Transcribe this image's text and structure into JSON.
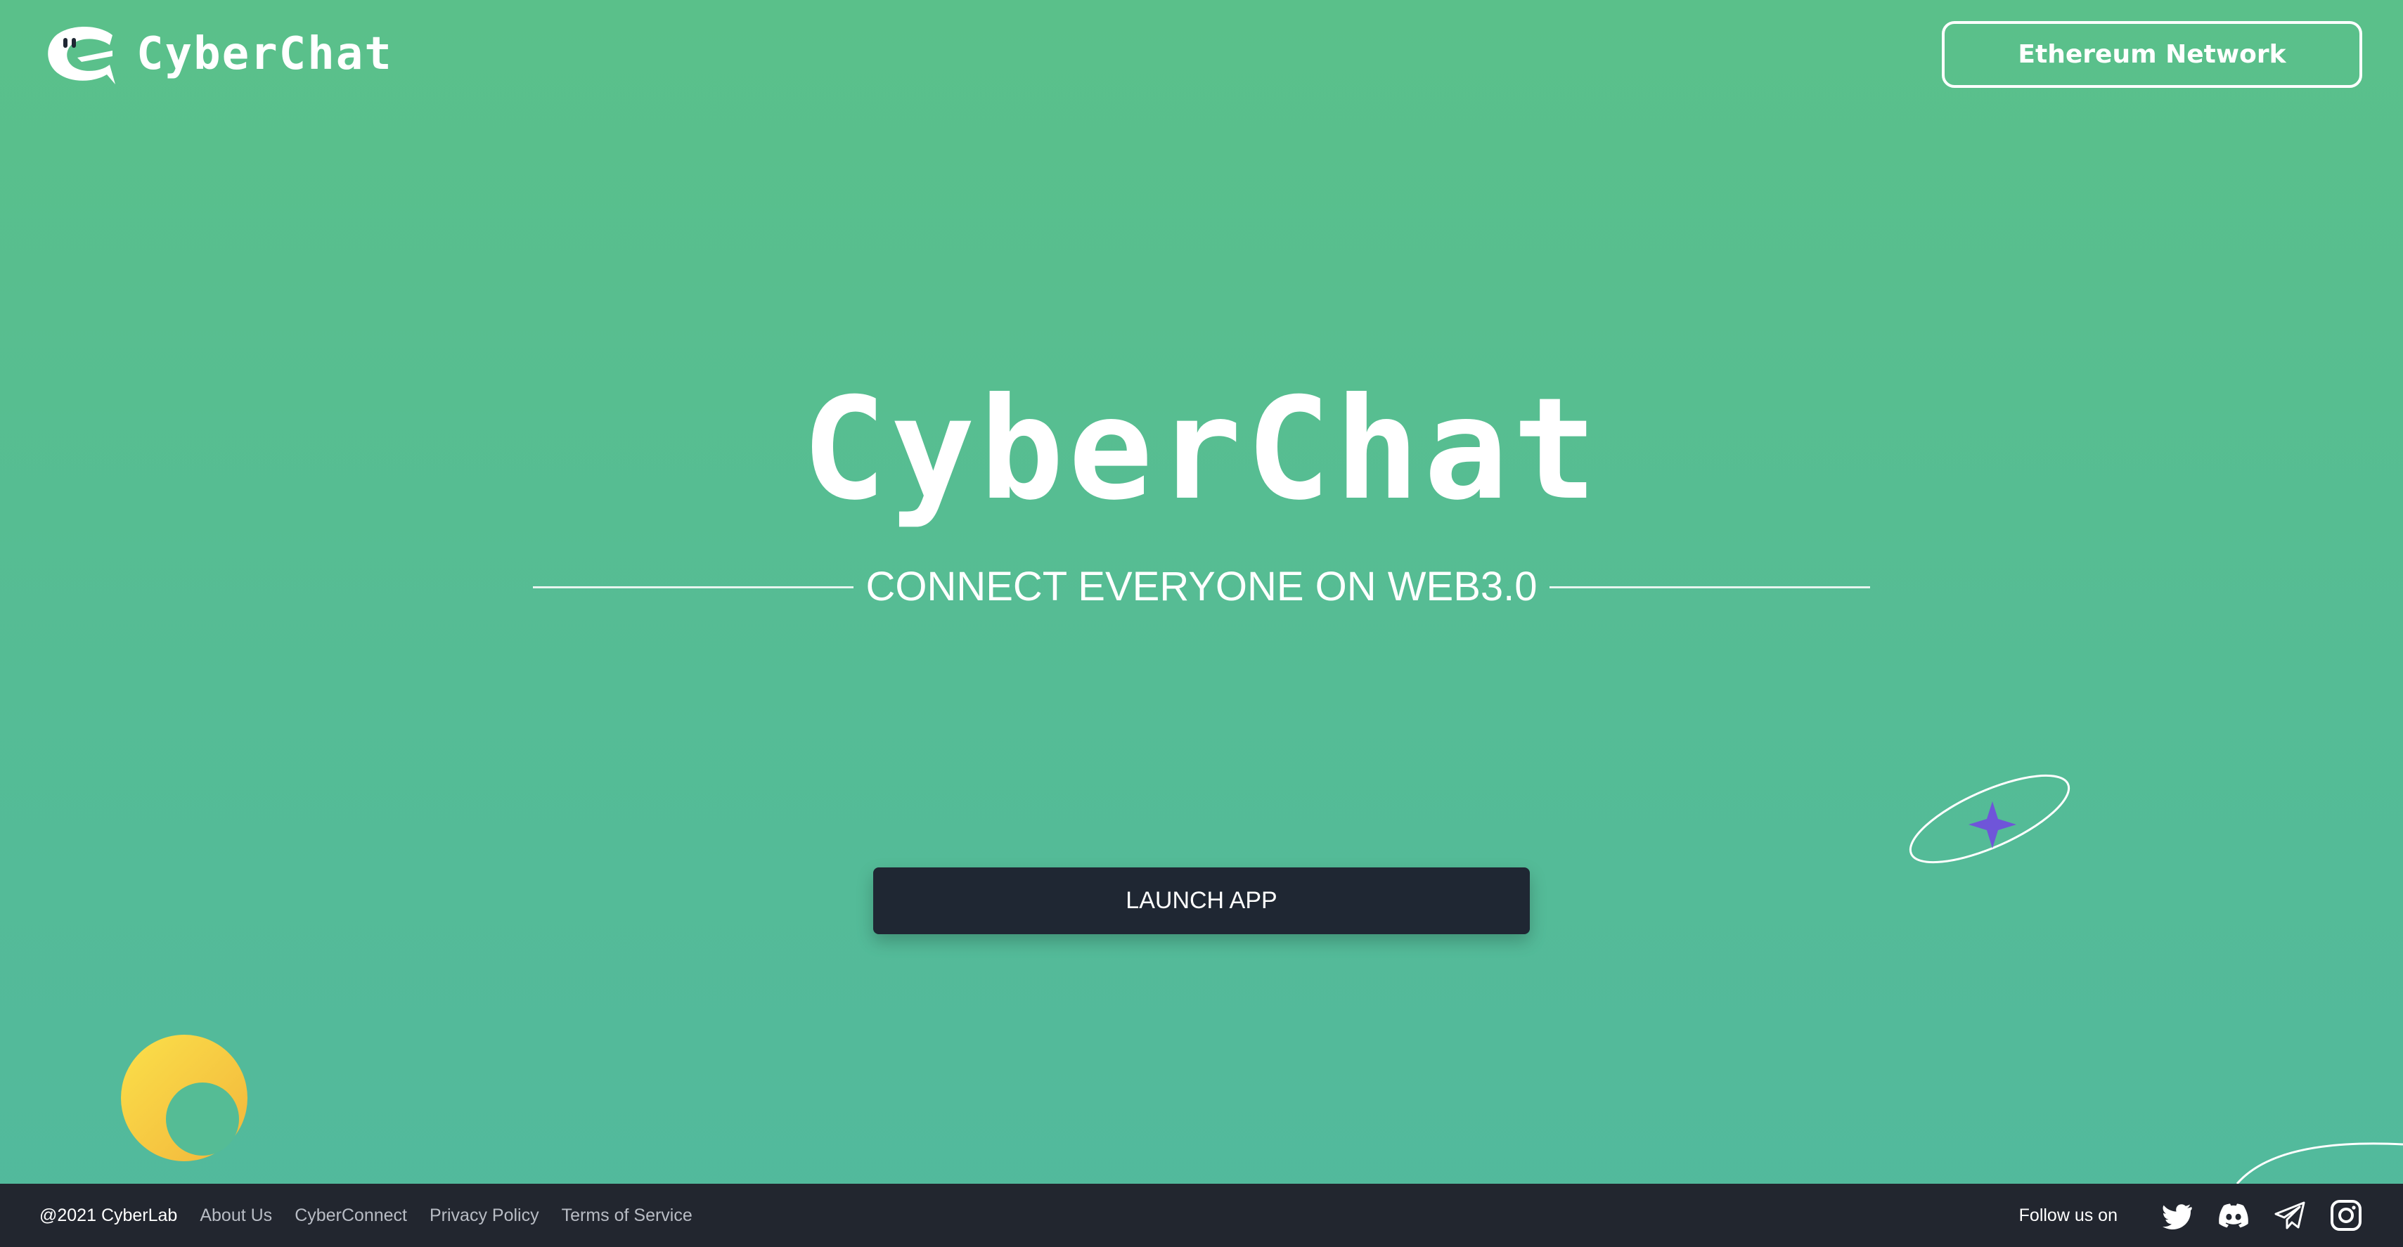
{
  "header": {
    "logo_text": "CyberChat",
    "network_button": "Ethereum Network"
  },
  "hero": {
    "title": "CyberChat",
    "subtitle": "CONNECT EVERYONE ON WEB3.0",
    "launch_button": "LAUNCH APP"
  },
  "footer": {
    "copyright": "@2021 CyberLab",
    "links": [
      {
        "label": "About Us"
      },
      {
        "label": "CyberConnect"
      },
      {
        "label": "Privacy Policy"
      },
      {
        "label": "Terms of Service"
      }
    ],
    "follow_text": "Follow us on",
    "social_icons": [
      "twitter-icon",
      "discord-icon",
      "telegram-icon",
      "instagram-icon"
    ]
  },
  "colors": {
    "background_top": "#5ac08a",
    "background_bottom": "#52b99d",
    "launch_button": "#1f2733",
    "footer": "#22262f",
    "moon": "#f7c843",
    "star": "#6f55d9"
  }
}
